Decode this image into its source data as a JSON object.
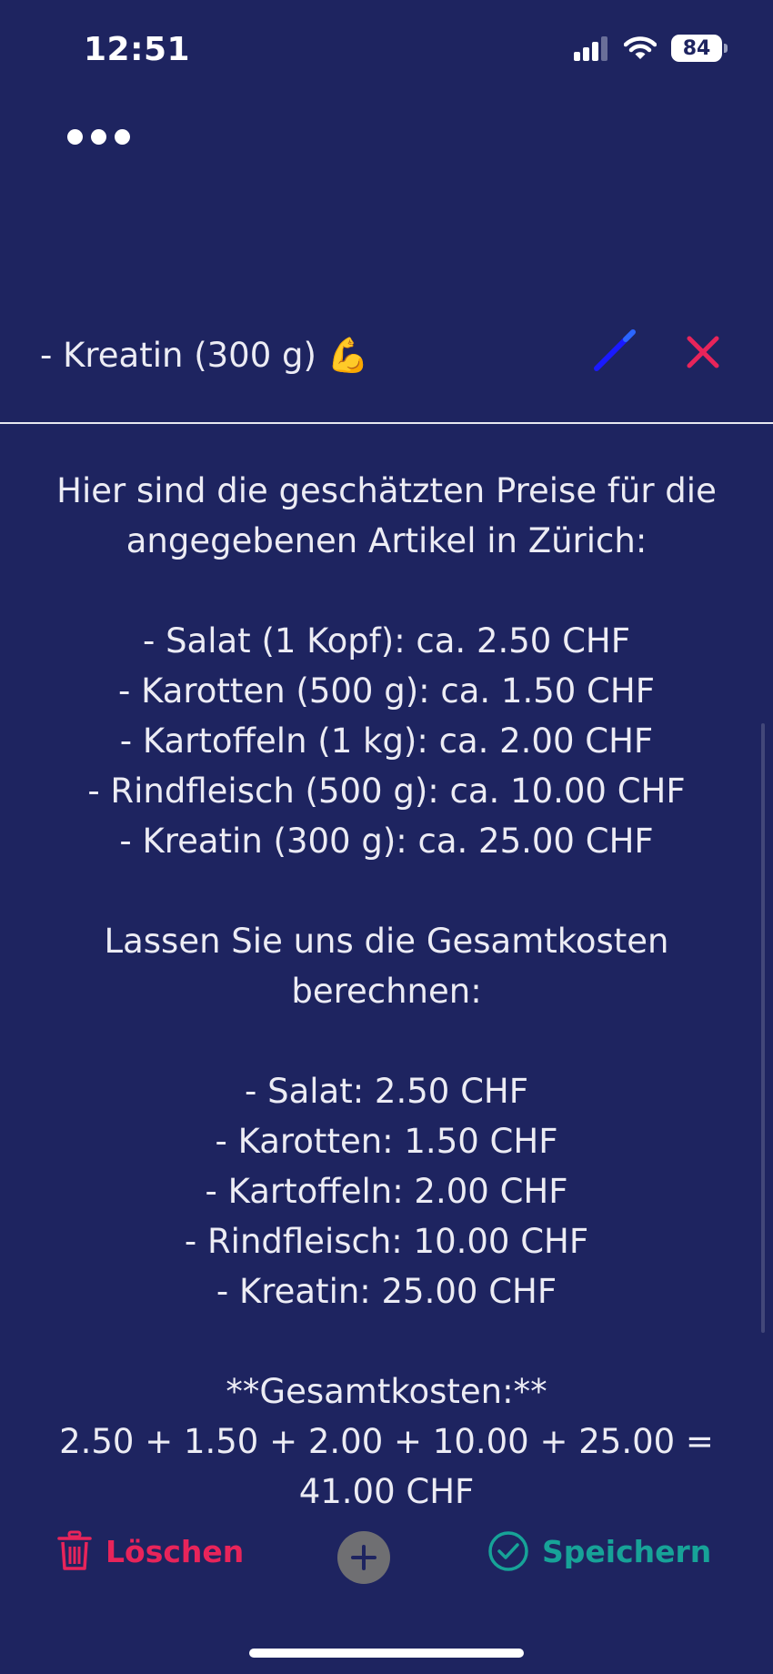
{
  "status_bar": {
    "time": "12:51",
    "battery_level": "84",
    "icons": [
      "signal-icon",
      "wifi-icon",
      "battery-icon"
    ]
  },
  "menu": {
    "icon": "more-dots-icon"
  },
  "entry": {
    "title": "- Kreatin (300 g) 💪",
    "edit_icon": "pencil-icon",
    "close_icon": "close-icon"
  },
  "content": {
    "text": "Hier sind die geschätzten Preise für die angegebenen Artikel in Zürich:\n\n- Salat (1 Kopf): ca. 2.50 CHF\n- Karotten (500 g): ca. 1.50 CHF\n- Kartoffeln (1 kg): ca. 2.00 CHF\n- Rindfleisch (500 g): ca. 10.00 CHF\n- Kreatin (300 g): ca. 25.00 CHF\n\nLassen Sie uns die Gesamtkosten berechnen:\n\n- Salat: 2.50 CHF\n- Karotten: 1.50 CHF\n- Kartoffeln: 2.00 CHF\n- Rindfleisch: 10.00 CHF\n- Kreatin: 25.00 CHF\n\n**Gesamtkosten:**\n2.50 + 1.50 + 2.00 + 10.00 + 25.00 = 41.00 CHF"
  },
  "actions": {
    "delete_label": "Löschen",
    "save_label": "Speichern",
    "add_icon": "plus-icon"
  },
  "colors": {
    "background": "#1e2460",
    "delete": "#e8245a",
    "save": "#17a398",
    "edit": "#1a1aff",
    "close": "#e8245a"
  }
}
